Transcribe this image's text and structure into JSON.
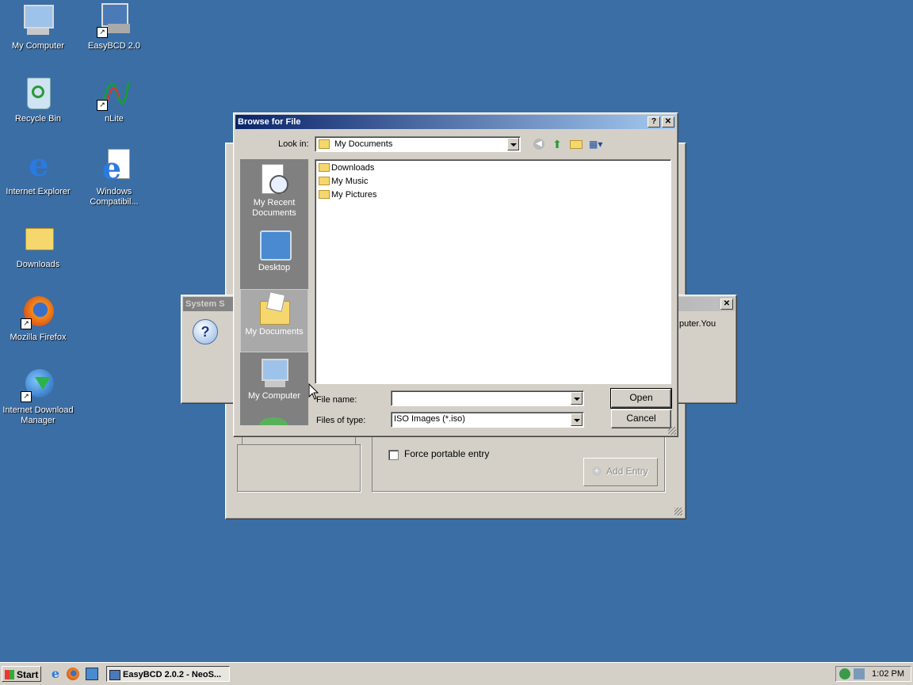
{
  "desktop": {
    "icons": [
      {
        "label": "My Computer",
        "icon": "my-computer-icon"
      },
      {
        "label": "EasyBCD 2.0",
        "icon": "easybcd-icon"
      },
      {
        "label": "Recycle Bin",
        "icon": "recycle-bin-icon"
      },
      {
        "label": "nLite",
        "icon": "nlite-icon"
      },
      {
        "label": "Internet Explorer",
        "icon": "internet-explorer-icon"
      },
      {
        "label": "Windows Compatibil...",
        "icon": "windows-compat-icon"
      },
      {
        "label": "Downloads",
        "icon": "folder-icon"
      },
      {
        "label": "Mozilla Firefox",
        "icon": "firefox-icon"
      },
      {
        "label": "Internet Download Manager",
        "icon": "idm-icon"
      }
    ]
  },
  "background_dialog": {
    "title": "System S",
    "text_fragment": "puter.You"
  },
  "easybcd_window": {
    "force_portable_label": "Force portable entry",
    "add_entry_label": "Add Entry"
  },
  "browse_dialog": {
    "title": "Browse for File",
    "help_label": "?",
    "close_label": "✕",
    "look_in_label": "Look in:",
    "look_in_value": "My Documents",
    "places": [
      {
        "label": "My Recent Documents",
        "icon": "recent-documents-icon"
      },
      {
        "label": "Desktop",
        "icon": "desktop-icon"
      },
      {
        "label": "My Documents",
        "icon": "my-documents-icon",
        "selected": true
      },
      {
        "label": "My Computer",
        "icon": "my-computer-icon"
      }
    ],
    "files": [
      "Downloads",
      "My Music",
      "My Pictures"
    ],
    "file_name_label": "File name:",
    "file_name_value": "",
    "file_type_label": "Files of type:",
    "file_type_value": "ISO Images (*.iso)",
    "open_label": "Open",
    "cancel_label": "Cancel"
  },
  "taskbar": {
    "start_label": "Start",
    "task_label": "EasyBCD 2.0.2  - NeoS...",
    "clock": "1:02 PM"
  }
}
